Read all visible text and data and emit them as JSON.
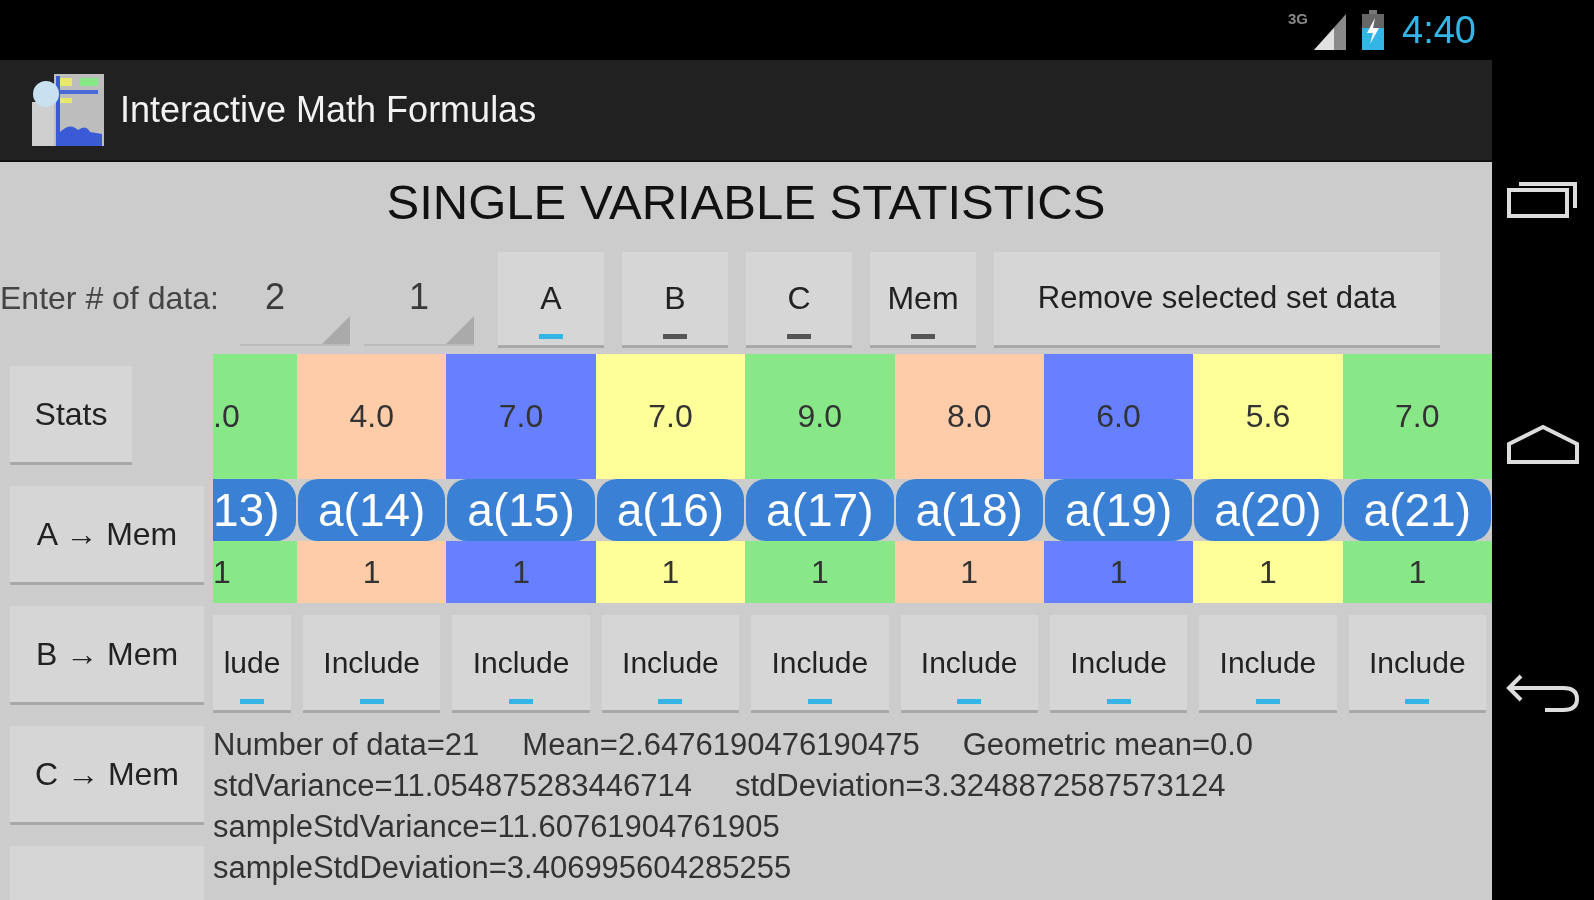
{
  "status_bar": {
    "network": "3G",
    "time": "4:40"
  },
  "app_bar": {
    "title": "Interactive Math Formulas"
  },
  "heading": "SINGLE VARIABLE STATISTICS",
  "count_entry": {
    "label": "Enter # of data:",
    "fields": [
      {
        "value": "2"
      },
      {
        "value": "1"
      }
    ]
  },
  "set_buttons": [
    {
      "label": "A",
      "selected": true
    },
    {
      "label": "B",
      "selected": false
    },
    {
      "label": "C",
      "selected": false
    },
    {
      "label": "Mem",
      "selected": false
    }
  ],
  "remove_button": "Remove selected set data",
  "side_buttons": [
    "Stats",
    "A → Mem",
    "B → Mem",
    "C → Mem"
  ],
  "data_columns": [
    {
      "value": ".0",
      "label": "13)",
      "weight": "1",
      "include": "lude",
      "included": true,
      "color": "#88e888"
    },
    {
      "value": "4.0",
      "label": "a(14)",
      "weight": "1",
      "include": "Include",
      "included": true,
      "color": "#ffccaa"
    },
    {
      "value": "7.0",
      "label": "a(15)",
      "weight": "1",
      "include": "Include",
      "included": true,
      "color": "#6680ff"
    },
    {
      "value": "7.0",
      "label": "a(16)",
      "weight": "1",
      "include": "Include",
      "included": true,
      "color": "#ffff99"
    },
    {
      "value": "9.0",
      "label": "a(17)",
      "weight": "1",
      "include": "Include",
      "included": true,
      "color": "#88e888"
    },
    {
      "value": "8.0",
      "label": "a(18)",
      "weight": "1",
      "include": "Include",
      "included": true,
      "color": "#ffccaa"
    },
    {
      "value": "6.0",
      "label": "a(19)",
      "weight": "1",
      "include": "Include",
      "included": true,
      "color": "#6680ff"
    },
    {
      "value": "5.6",
      "label": "a(20)",
      "weight": "1",
      "include": "Include",
      "included": true,
      "color": "#ffff99"
    },
    {
      "value": "7.0",
      "label": "a(21)",
      "weight": "1",
      "include": "Include",
      "included": true,
      "color": "#88e888"
    }
  ],
  "stats_lines": [
    "Number of data=21     Mean=2.6476190476190475     Geometric mean=0.0",
    "stdVariance=11.054875283446714     stdDeviation=3.3248872587573124",
    "sampleStdVariance=11.60761904761905",
    "sampleStdDeviation=3.406995604285255"
  ]
}
